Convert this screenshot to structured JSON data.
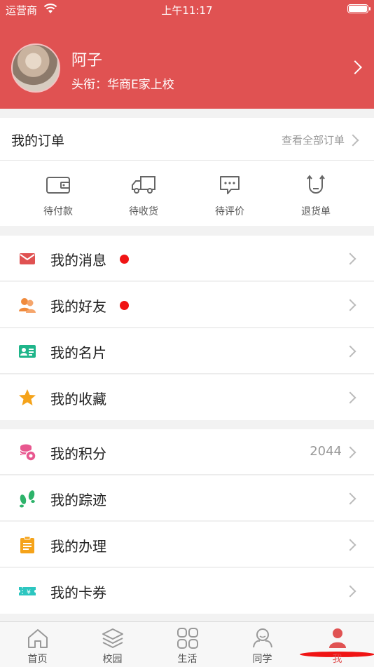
{
  "status_bar": {
    "carrier": "运营商",
    "time": "上午11:17"
  },
  "profile": {
    "name": "阿子",
    "title": "头衔：华商E家上校"
  },
  "orders": {
    "title": "我的订单",
    "view_all": "查看全部订单",
    "items": [
      {
        "label": "待付款",
        "icon": "wallet-icon"
      },
      {
        "label": "待收货",
        "icon": "truck-icon"
      },
      {
        "label": "待评价",
        "icon": "comment-icon"
      },
      {
        "label": "退货单",
        "icon": "return-icon"
      }
    ]
  },
  "menu": {
    "messages": {
      "label": "我的消息",
      "icon": "envelope-icon",
      "color": "#e05252",
      "has_dot": true
    },
    "friends": {
      "label": "我的好友",
      "icon": "friends-icon",
      "color": "#f08a3c",
      "has_dot": true
    },
    "card": {
      "label": "我的名片",
      "icon": "id-card-icon",
      "color": "#1fb58a"
    },
    "favorites": {
      "label": "我的收藏",
      "icon": "star-icon",
      "color": "#f5a31a"
    },
    "points": {
      "label": "我的积分",
      "icon": "coins-icon",
      "color": "#e8578f",
      "value": "2044"
    },
    "footprints": {
      "label": "我的踪迹",
      "icon": "footprint-icon",
      "color": "#2db36a"
    },
    "handle": {
      "label": "我的办理",
      "icon": "clipboard-icon",
      "color": "#f5a31a"
    },
    "coupons": {
      "label": "我的卡券",
      "icon": "ticket-icon",
      "color": "#2cc6c0"
    }
  },
  "tabbar": {
    "tabs": [
      {
        "label": "首页",
        "icon": "home-icon"
      },
      {
        "label": "校园",
        "icon": "layers-icon"
      },
      {
        "label": "生活",
        "icon": "grid-icon"
      },
      {
        "label": "同学",
        "icon": "classmates-icon"
      },
      {
        "label": "我",
        "icon": "person-icon",
        "active": true
      }
    ]
  },
  "colors": {
    "primary": "#e05252",
    "badge": "#f01414",
    "background": "#f2f2f2"
  }
}
